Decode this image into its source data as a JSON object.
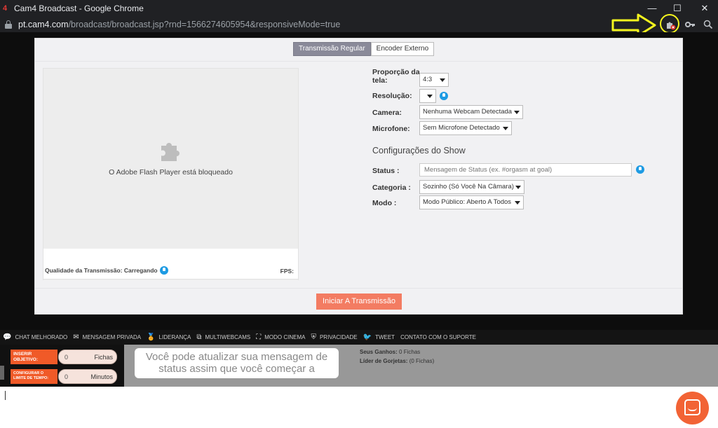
{
  "browser": {
    "title": "Cam4 Broadcast - Google Chrome",
    "url_host": "pt.cam4.com",
    "url_path": "/broadcast/broadcast.jsp?rnd=1566274605954&responsiveMode=true",
    "favicon_text": "4",
    "window_controls": [
      "minimize-icon",
      "maximize-icon",
      "close-icon"
    ],
    "toolbar_icons": [
      "plugin-blocked-icon",
      "key-icon",
      "zoom-icon"
    ]
  },
  "tabs": [
    {
      "label": "Transmissão Regular",
      "active": true
    },
    {
      "label": "Encoder Externo",
      "active": false
    }
  ],
  "video": {
    "blocked_text": "O Adobe Flash Player está bloqueado",
    "quality_label": "Qualidade da Transmissão: Carregando",
    "fps_label": "FPS:"
  },
  "settings": {
    "aspect_label_1": "Proporção da",
    "aspect_label_2": "tela:",
    "aspect_value": "4:3",
    "resolution_label": "Resolução:",
    "resolution_value": "",
    "camera_label": "Camera:",
    "camera_value": "Nenhuma Webcam Detectada",
    "mic_label": "Microfone:",
    "mic_value": "Sem Microfone Detectado"
  },
  "show": {
    "section_title": "Configurações do Show",
    "status_label": "Status :",
    "status_placeholder": "Mensagem de Status (ex. #orgasm at goal)",
    "category_label": "Categoria :",
    "category_value": "Sozinho (Só Você Na Câmara)",
    "mode_label": "Modo :",
    "mode_value": "Modo Público: Aberto A Todos"
  },
  "start_button": "Iniciar A Transmissão",
  "nav": [
    {
      "icon": "chat-bubble-icon",
      "glyph": "💬",
      "label": "CHAT MELHORADO"
    },
    {
      "icon": "envelope-icon",
      "glyph": "✉",
      "label": "MENSAGEM PRIVADA"
    },
    {
      "icon": "medal-icon",
      "glyph": "🏅",
      "label": "LIDERANÇA"
    },
    {
      "icon": "multiwindow-icon",
      "glyph": "⧉",
      "label": "MULTIWEBCAMS"
    },
    {
      "icon": "fullscreen-icon",
      "glyph": "⛶",
      "label": "MODO CINEMA"
    },
    {
      "icon": "shield-icon",
      "glyph": "⛨",
      "label": "PRIVACIDADE"
    },
    {
      "icon": "twitter-icon",
      "glyph": "🐦",
      "label": "TWEET"
    },
    {
      "icon": "",
      "glyph": "",
      "label": "CONTATO COM O SUPORTE"
    }
  ],
  "goal": {
    "goal_label_1": "INSERIR",
    "goal_label_2": "OBJETIVO:",
    "goal_value": "0",
    "goal_unit": "Fichas",
    "time_label_1": "CONFIGURAR O",
    "time_label_2": "LIMITE DE TEMPO:",
    "time_value": "0",
    "time_unit": "Minutos"
  },
  "status_message": "Você pode atualizar sua mensagem de status assim que você começar a",
  "earnings": {
    "earnings_label": "Seus Ganhos:",
    "earnings_value": "0 Fichas",
    "tipper_label": "Líder de Gorjetas:",
    "tipper_value": "(0 Fichas)"
  },
  "colors": {
    "accent": "#f37c62",
    "goal_orange": "#f05a28",
    "tip_blue": "#1e9be3",
    "annotation_yellow": "#f5f51e"
  }
}
